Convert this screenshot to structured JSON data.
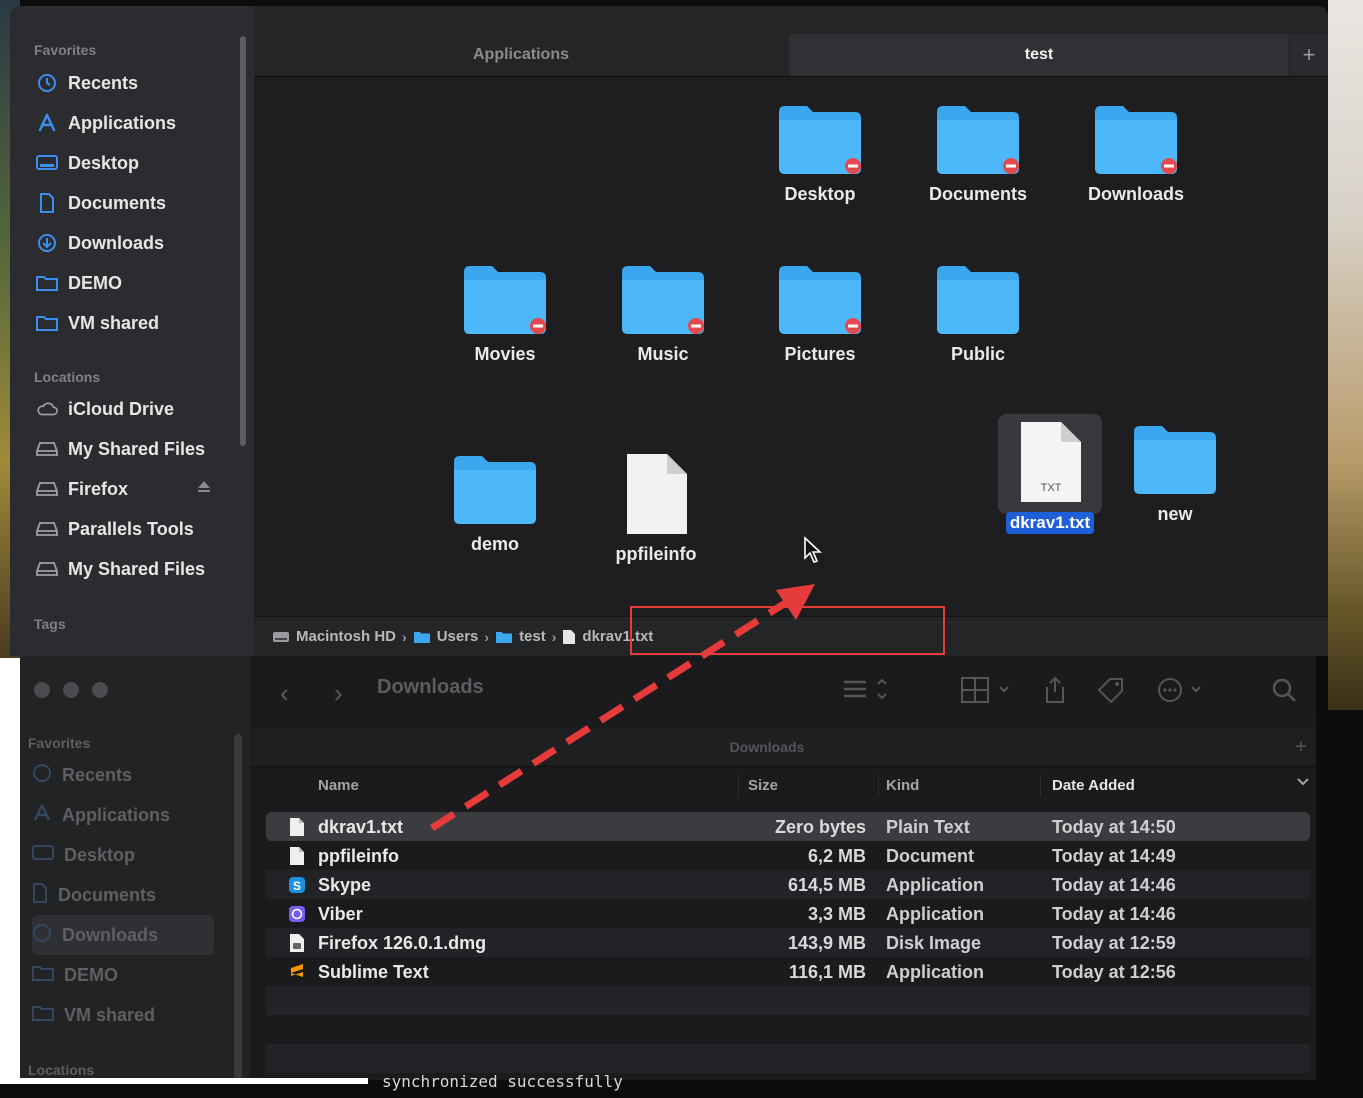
{
  "window1": {
    "sidebar": {
      "favorites_header": "Favorites",
      "favorites": [
        {
          "label": "Recents",
          "icon": "clock-icon"
        },
        {
          "label": "Applications",
          "icon": "applications-icon"
        },
        {
          "label": "Desktop",
          "icon": "desktop-icon"
        },
        {
          "label": "Documents",
          "icon": "document-icon"
        },
        {
          "label": "Downloads",
          "icon": "download-icon"
        },
        {
          "label": "DEMO",
          "icon": "folder-icon"
        },
        {
          "label": "VM shared",
          "icon": "folder-icon"
        }
      ],
      "locations_header": "Locations",
      "locations": [
        {
          "label": "iCloud Drive",
          "icon": "cloud-icon"
        },
        {
          "label": "My Shared Files",
          "icon": "drive-icon"
        },
        {
          "label": "Firefox",
          "icon": "drive-icon"
        },
        {
          "label": "Parallels Tools",
          "icon": "drive-icon"
        },
        {
          "label": "My Shared Files",
          "icon": "drive-icon"
        }
      ],
      "tags_header": "Tags"
    },
    "tabs": [
      {
        "label": "Applications",
        "active": false
      },
      {
        "label": "test",
        "active": true
      }
    ],
    "tab_add": "+",
    "items": [
      {
        "label": "Desktop",
        "type": "folder-locked"
      },
      {
        "label": "Documents",
        "type": "folder-locked"
      },
      {
        "label": "Downloads",
        "type": "folder-locked"
      },
      {
        "label": "Movies",
        "type": "folder-locked"
      },
      {
        "label": "Music",
        "type": "folder-locked"
      },
      {
        "label": "Pictures",
        "type": "folder-locked"
      },
      {
        "label": "Public",
        "type": "folder"
      },
      {
        "label": "demo",
        "type": "folder"
      },
      {
        "label": "ppfileinfo",
        "type": "file"
      },
      {
        "label": "dkrav1.txt",
        "type": "txt",
        "selected": true,
        "badge": "TXT"
      },
      {
        "label": "new",
        "type": "folder"
      }
    ],
    "path": [
      "Macintosh HD",
      "Users",
      "test",
      "dkrav1.txt"
    ]
  },
  "window2": {
    "title": "Downloads",
    "tab": "Downloads",
    "tab_add": "+",
    "sidebar": {
      "favorites_header": "Favorites",
      "favorites": [
        {
          "label": "Recents"
        },
        {
          "label": "Applications"
        },
        {
          "label": "Desktop"
        },
        {
          "label": "Documents"
        },
        {
          "label": "Downloads",
          "selected": true
        },
        {
          "label": "DEMO"
        },
        {
          "label": "VM shared"
        }
      ],
      "locations_header": "Locations"
    },
    "columns": {
      "name": "Name",
      "size": "Size",
      "kind": "Kind",
      "date": "Date Added"
    },
    "rows": [
      {
        "name": "dkrav1.txt",
        "size": "Zero bytes",
        "kind": "Plain Text",
        "date": "Today at 14:50",
        "icon": "file-icon"
      },
      {
        "name": "ppfileinfo",
        "size": "6,2 MB",
        "kind": "Document",
        "date": "Today at 14:49",
        "icon": "file-icon"
      },
      {
        "name": "Skype",
        "size": "614,5 MB",
        "kind": "Application",
        "date": "Today at 14:46",
        "icon": "skype-icon"
      },
      {
        "name": "Viber",
        "size": "3,3 MB",
        "kind": "Application",
        "date": "Today at 14:46",
        "icon": "viber-icon"
      },
      {
        "name": "Firefox 126.0.1.dmg",
        "size": "143,9 MB",
        "kind": "Disk Image",
        "date": "Today at 12:59",
        "icon": "disk-image-icon"
      },
      {
        "name": "Sublime Text",
        "size": "116,1 MB",
        "kind": "Application",
        "date": "Today at 12:56",
        "icon": "sublime-icon"
      }
    ]
  },
  "terminal": {
    "line1": "synchronized successfully"
  },
  "colors": {
    "accent": "#1f5fd8",
    "annotation": "#e63b3b",
    "folder": "#3aa7ef"
  }
}
